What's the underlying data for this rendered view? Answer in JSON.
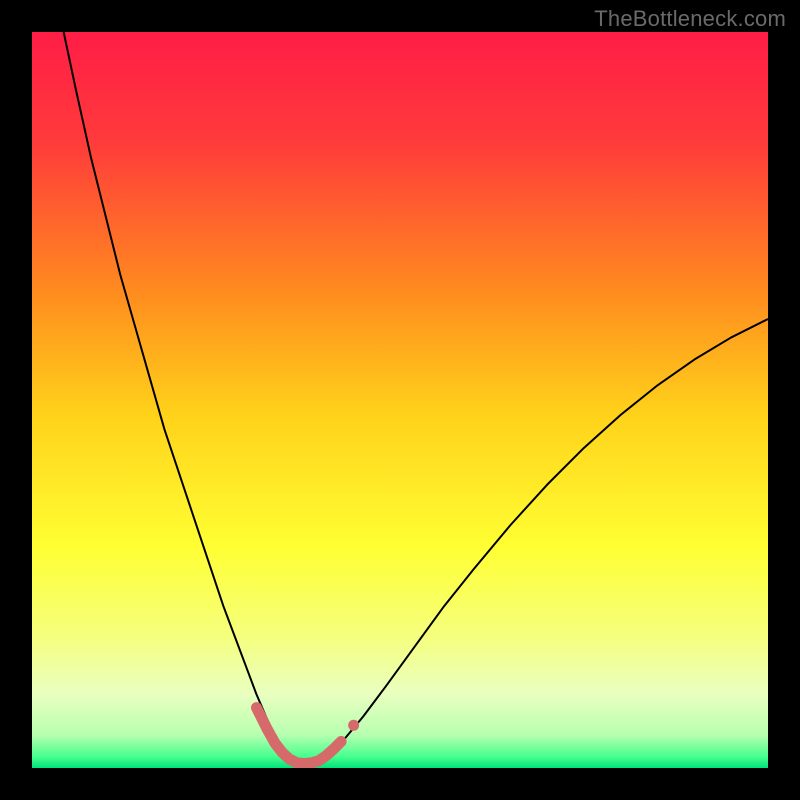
{
  "watermark": "TheBottleneck.com",
  "chart_data": {
    "type": "line",
    "title": "",
    "xlabel": "",
    "ylabel": "",
    "xlim": [
      0,
      100
    ],
    "ylim": [
      0,
      100
    ],
    "grid": false,
    "legend": false,
    "background_gradient_stops": [
      {
        "offset": 0.0,
        "color": "#ff1d46"
      },
      {
        "offset": 0.15,
        "color": "#ff3b3b"
      },
      {
        "offset": 0.35,
        "color": "#ff8a1f"
      },
      {
        "offset": 0.52,
        "color": "#ffd21a"
      },
      {
        "offset": 0.7,
        "color": "#ffff33"
      },
      {
        "offset": 0.82,
        "color": "#f5ff7d"
      },
      {
        "offset": 0.9,
        "color": "#e9ffc0"
      },
      {
        "offset": 0.955,
        "color": "#b7ffb0"
      },
      {
        "offset": 0.985,
        "color": "#45ff8d"
      },
      {
        "offset": 1.0,
        "color": "#00e37a"
      }
    ],
    "series": [
      {
        "name": "bottleneck-curve",
        "stroke": "#000000",
        "stroke_width": 2,
        "x": [
          4.3,
          6,
          8,
          10,
          12,
          14,
          16,
          18,
          20,
          22,
          24,
          26,
          27.5,
          29,
          30.5,
          32,
          33,
          34,
          35,
          36,
          38,
          40,
          42,
          45,
          48,
          52,
          56,
          60,
          65,
          70,
          75,
          80,
          85,
          90,
          95,
          100
        ],
        "y": [
          100,
          92,
          83,
          75,
          67,
          60,
          53,
          46,
          40,
          34,
          28,
          22,
          18,
          14,
          10,
          6.5,
          4.2,
          2.5,
          1.3,
          0.6,
          0.6,
          1.6,
          3.4,
          7.0,
          11.0,
          16.5,
          22.0,
          27.0,
          33.0,
          38.5,
          43.5,
          48.0,
          52.0,
          55.5,
          58.5,
          61.0
        ]
      },
      {
        "name": "highlight-band",
        "stroke": "#d66a6a",
        "stroke_width": 11,
        "linecap": "round",
        "x": [
          30.5,
          32,
          33,
          34,
          35,
          36,
          37,
          38,
          39,
          40,
          41,
          42
        ],
        "y": [
          8.2,
          5.2,
          3.4,
          2.1,
          1.2,
          0.7,
          0.6,
          0.7,
          1.0,
          1.7,
          2.6,
          3.6
        ]
      },
      {
        "name": "highlight-top-dot",
        "type_hint": "marker",
        "fill": "#d66a6a",
        "x": [
          43.7
        ],
        "y": [
          5.8
        ],
        "r": 5.5
      }
    ]
  }
}
